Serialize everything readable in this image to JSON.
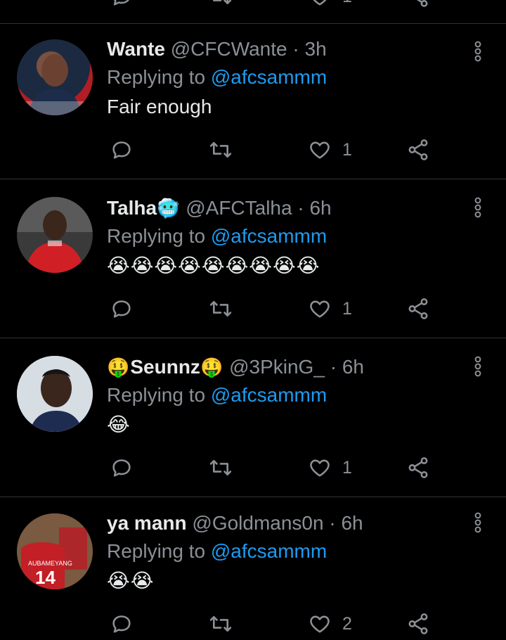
{
  "tweets": [
    {
      "name": "Wante",
      "name_prefix_emoji": "",
      "name_suffix_emoji": "",
      "handle": "@CFCWante",
      "separator": "·",
      "time": "3h",
      "reply_prefix": "Replying to",
      "reply_user": "@afcsammm",
      "text": "Fair enough",
      "like_count": "1",
      "avatar": "avatar-1"
    },
    {
      "name": "Talha",
      "name_prefix_emoji": "",
      "name_suffix_emoji": "🥶",
      "handle": "@AFCTalha",
      "separator": "·",
      "time": "6h",
      "reply_prefix": "Replying to",
      "reply_user": "@afcsammm",
      "text": "😭😭😭😭😭😭😭😭😭",
      "like_count": "1",
      "avatar": "avatar-2"
    },
    {
      "name": "Seunnz",
      "name_prefix_emoji": "🤑",
      "name_suffix_emoji": "🤑",
      "handle": "@3PkinG_",
      "separator": "·",
      "time": "6h",
      "reply_prefix": "Replying to",
      "reply_user": "@afcsammm",
      "text": "😂",
      "like_count": "1",
      "avatar": "avatar-3"
    },
    {
      "name": "ya mann",
      "name_prefix_emoji": "",
      "name_suffix_emoji": "",
      "handle": "@Goldmans0n",
      "separator": "·",
      "time": "6h",
      "reply_prefix": "Replying to",
      "reply_user": "@afcsammm",
      "text": "😭😭",
      "like_count": "2",
      "avatar": "avatar-4"
    }
  ],
  "top_partial_row": {
    "like_count": "1"
  },
  "icons": {
    "reply": "reply-icon",
    "retweet": "retweet-icon",
    "like": "like-icon",
    "share": "share-icon",
    "more": "more-icon"
  },
  "colors": {
    "background": "#000000",
    "text": "#e7e9ea",
    "secondary": "#8b9096",
    "link": "#1d9bf0",
    "divider": "#2f3336"
  }
}
